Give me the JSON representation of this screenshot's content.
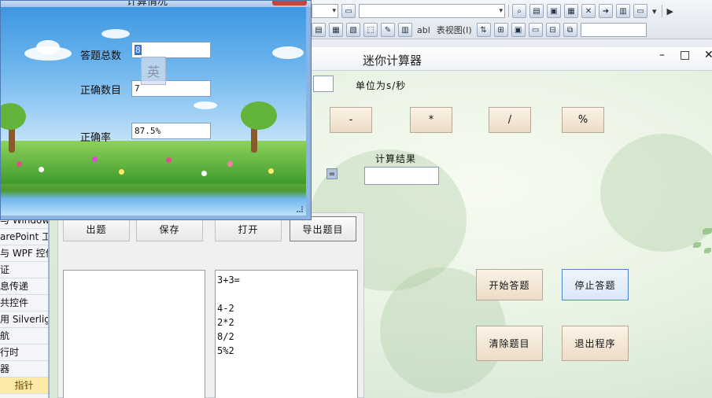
{
  "ide": {
    "toolbar_text": "abl",
    "view_menu": "表视图(I)",
    "left_panel_items": [
      "与 Windows",
      "arePoint 工",
      "与 WPF 控件",
      "证",
      "息传递",
      "共控件",
      "用 Silverligh",
      "航",
      "行时",
      "器"
    ],
    "left_panel_highlight": "指针"
  },
  "calculator": {
    "title": "迷你计算器",
    "minimize": "–",
    "maximize": "□",
    "unit_label": "单位为s/秒",
    "operators": [
      "-",
      "*",
      "/",
      "%"
    ],
    "equals": "=",
    "result_label": "计算结果",
    "actions": {
      "start": "开始答题",
      "stop": "停止答题",
      "clear": "清除题目",
      "exit": "退出程序"
    },
    "question_panel": {
      "buttons": [
        "出题",
        "保存",
        "打开",
        "导出题目"
      ],
      "questions": [
        "3+3=",
        "",
        "4-2",
        "2*2",
        "8/2",
        "5%2"
      ]
    }
  },
  "popup": {
    "title": "计算情况",
    "ime_indicator": "英",
    "fields": {
      "total": {
        "label": "答题总数",
        "value": "8"
      },
      "correct": {
        "label": "正确数目",
        "value": "7"
      },
      "rate": {
        "label": "正确率",
        "value": "87.5%"
      }
    }
  }
}
